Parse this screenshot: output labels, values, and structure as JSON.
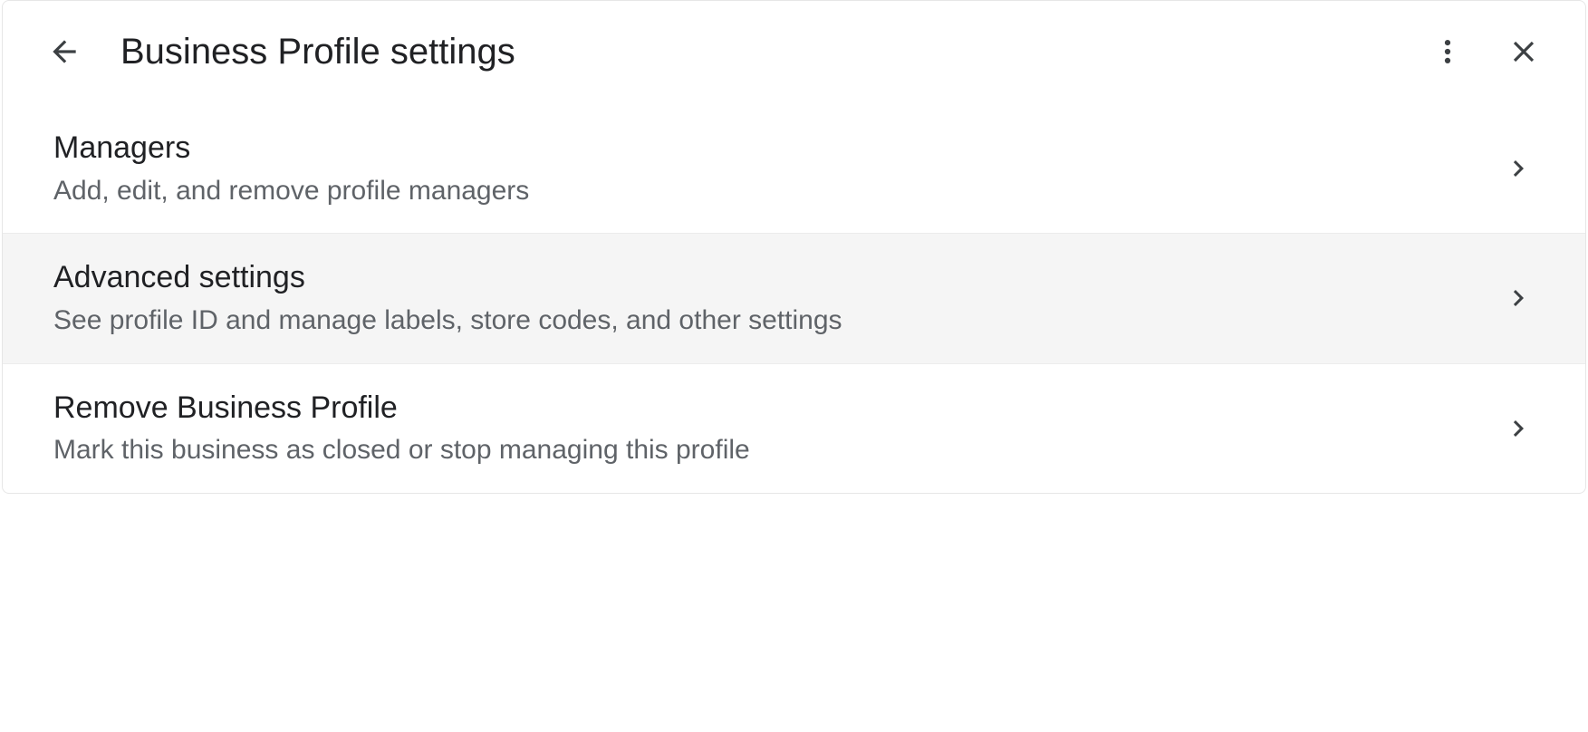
{
  "header": {
    "title": "Business Profile settings"
  },
  "items": [
    {
      "title": "Managers",
      "desc": "Add, edit, and remove profile managers",
      "highlight": false
    },
    {
      "title": "Advanced settings",
      "desc": "See profile ID and manage labels, store codes, and other settings",
      "highlight": true
    },
    {
      "title": "Remove Business Profile",
      "desc": "Mark this business as closed or stop managing this profile",
      "highlight": false
    }
  ]
}
